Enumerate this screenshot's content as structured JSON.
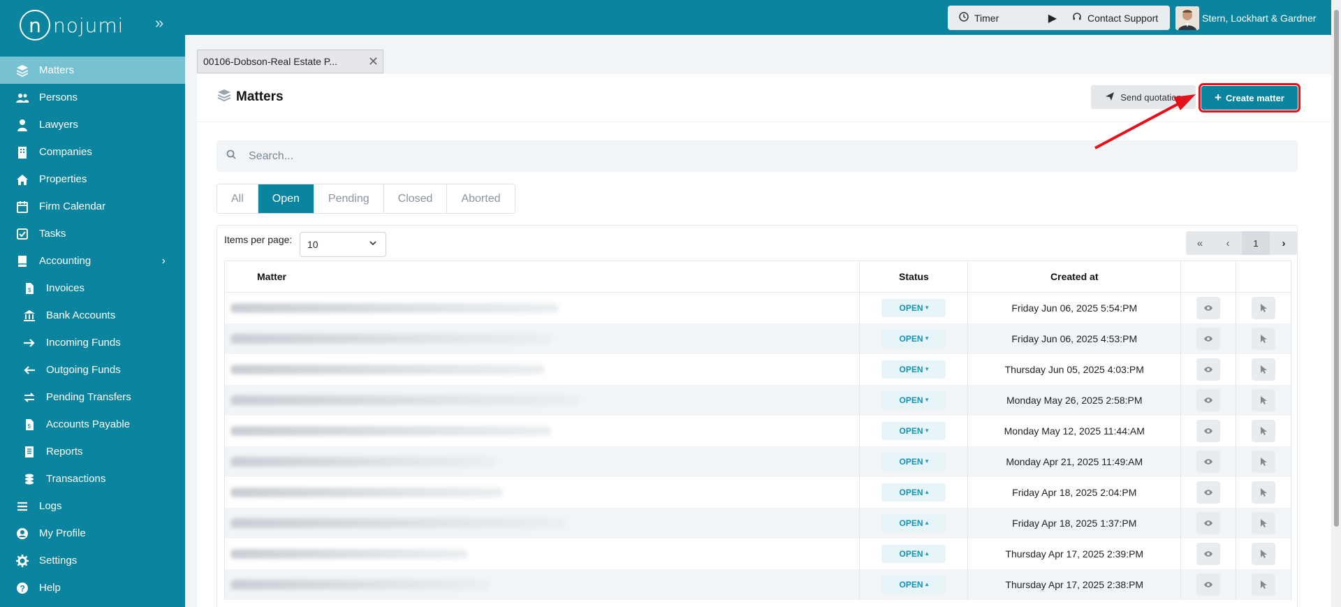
{
  "app": {
    "logo_text": "nojumi"
  },
  "sidebar": {
    "items": [
      {
        "label": "Matters",
        "icon": "layers-icon",
        "active": true
      },
      {
        "label": "Persons",
        "icon": "users-icon"
      },
      {
        "label": "Lawyers",
        "icon": "user-tie-icon"
      },
      {
        "label": "Companies",
        "icon": "building-icon"
      },
      {
        "label": "Properties",
        "icon": "house-icon"
      },
      {
        "label": "Firm Calendar",
        "icon": "calendar-icon"
      },
      {
        "label": "Tasks",
        "icon": "checkbox-icon"
      },
      {
        "label": "Accounting",
        "icon": "book-icon",
        "has_children": true
      },
      {
        "label": "Invoices",
        "icon": "invoice-icon",
        "sub": true
      },
      {
        "label": "Bank Accounts",
        "icon": "bank-icon",
        "sub": true
      },
      {
        "label": "Incoming Funds",
        "icon": "arrow-right-icon",
        "sub": true
      },
      {
        "label": "Outgoing Funds",
        "icon": "arrow-left-icon",
        "sub": true
      },
      {
        "label": "Pending Transfers",
        "icon": "transfer-icon",
        "sub": true
      },
      {
        "label": "Accounts Payable",
        "icon": "payable-icon",
        "sub": true
      },
      {
        "label": "Reports",
        "icon": "report-icon",
        "sub": true
      },
      {
        "label": "Transactions",
        "icon": "coins-icon",
        "sub": true
      },
      {
        "label": "Logs",
        "icon": "list-icon"
      },
      {
        "label": "My Profile",
        "icon": "profile-icon"
      },
      {
        "label": "Settings",
        "icon": "gear-icon"
      },
      {
        "label": "Help",
        "icon": "help-icon"
      }
    ]
  },
  "topbar": {
    "timer_label": "Timer",
    "support_label": "Contact Support",
    "firm_name": "Stern, Lockhart & Gardner"
  },
  "doc_tab": {
    "label": "00106-Dobson-Real Estate P..."
  },
  "page": {
    "title": "Matters",
    "send_quotation_label": "Send quotation",
    "create_matter_label": "Create matter",
    "search_placeholder": "Search...",
    "status_tabs": [
      {
        "label": "All"
      },
      {
        "label": "Open",
        "active": true
      },
      {
        "label": "Pending"
      },
      {
        "label": "Closed"
      },
      {
        "label": "Aborted"
      }
    ],
    "items_per_page_label": "Items per page:",
    "items_per_page_value": "10",
    "current_page": "1"
  },
  "table": {
    "headers": {
      "matter": "Matter",
      "status": "Status",
      "created": "Created at"
    },
    "rows": [
      {
        "status": "OPEN",
        "caret": "▾",
        "created": "Friday Jun 06, 2025 5:54:PM",
        "w": 470
      },
      {
        "status": "OPEN",
        "caret": "▾",
        "created": "Friday Jun 06, 2025 4:53:PM",
        "w": 460
      },
      {
        "status": "OPEN",
        "caret": "▾",
        "created": "Thursday Jun 05, 2025 4:03:PM",
        "w": 450
      },
      {
        "status": "OPEN",
        "caret": "▾",
        "created": "Monday May 26, 2025 2:58:PM",
        "w": 500
      },
      {
        "status": "OPEN",
        "caret": "▾",
        "created": "Monday May 12, 2025 11:44:AM",
        "w": 460
      },
      {
        "status": "OPEN",
        "caret": "▾",
        "created": "Monday Apr 21, 2025 11:49:AM",
        "w": 380
      },
      {
        "status": "OPEN",
        "caret": "▴",
        "created": "Friday Apr 18, 2025 2:04:PM",
        "w": 390
      },
      {
        "status": "OPEN",
        "caret": "▴",
        "created": "Friday Apr 18, 2025 1:37:PM",
        "w": 480
      },
      {
        "status": "OPEN",
        "caret": "▴",
        "created": "Thursday Apr 17, 2025 2:39:PM",
        "w": 340
      },
      {
        "status": "OPEN",
        "caret": "▴",
        "created": "Thursday Apr 17, 2025 2:38:PM",
        "w": 370
      }
    ]
  },
  "colors": {
    "brand": "#0b859f",
    "highlight": "#e4111a"
  }
}
